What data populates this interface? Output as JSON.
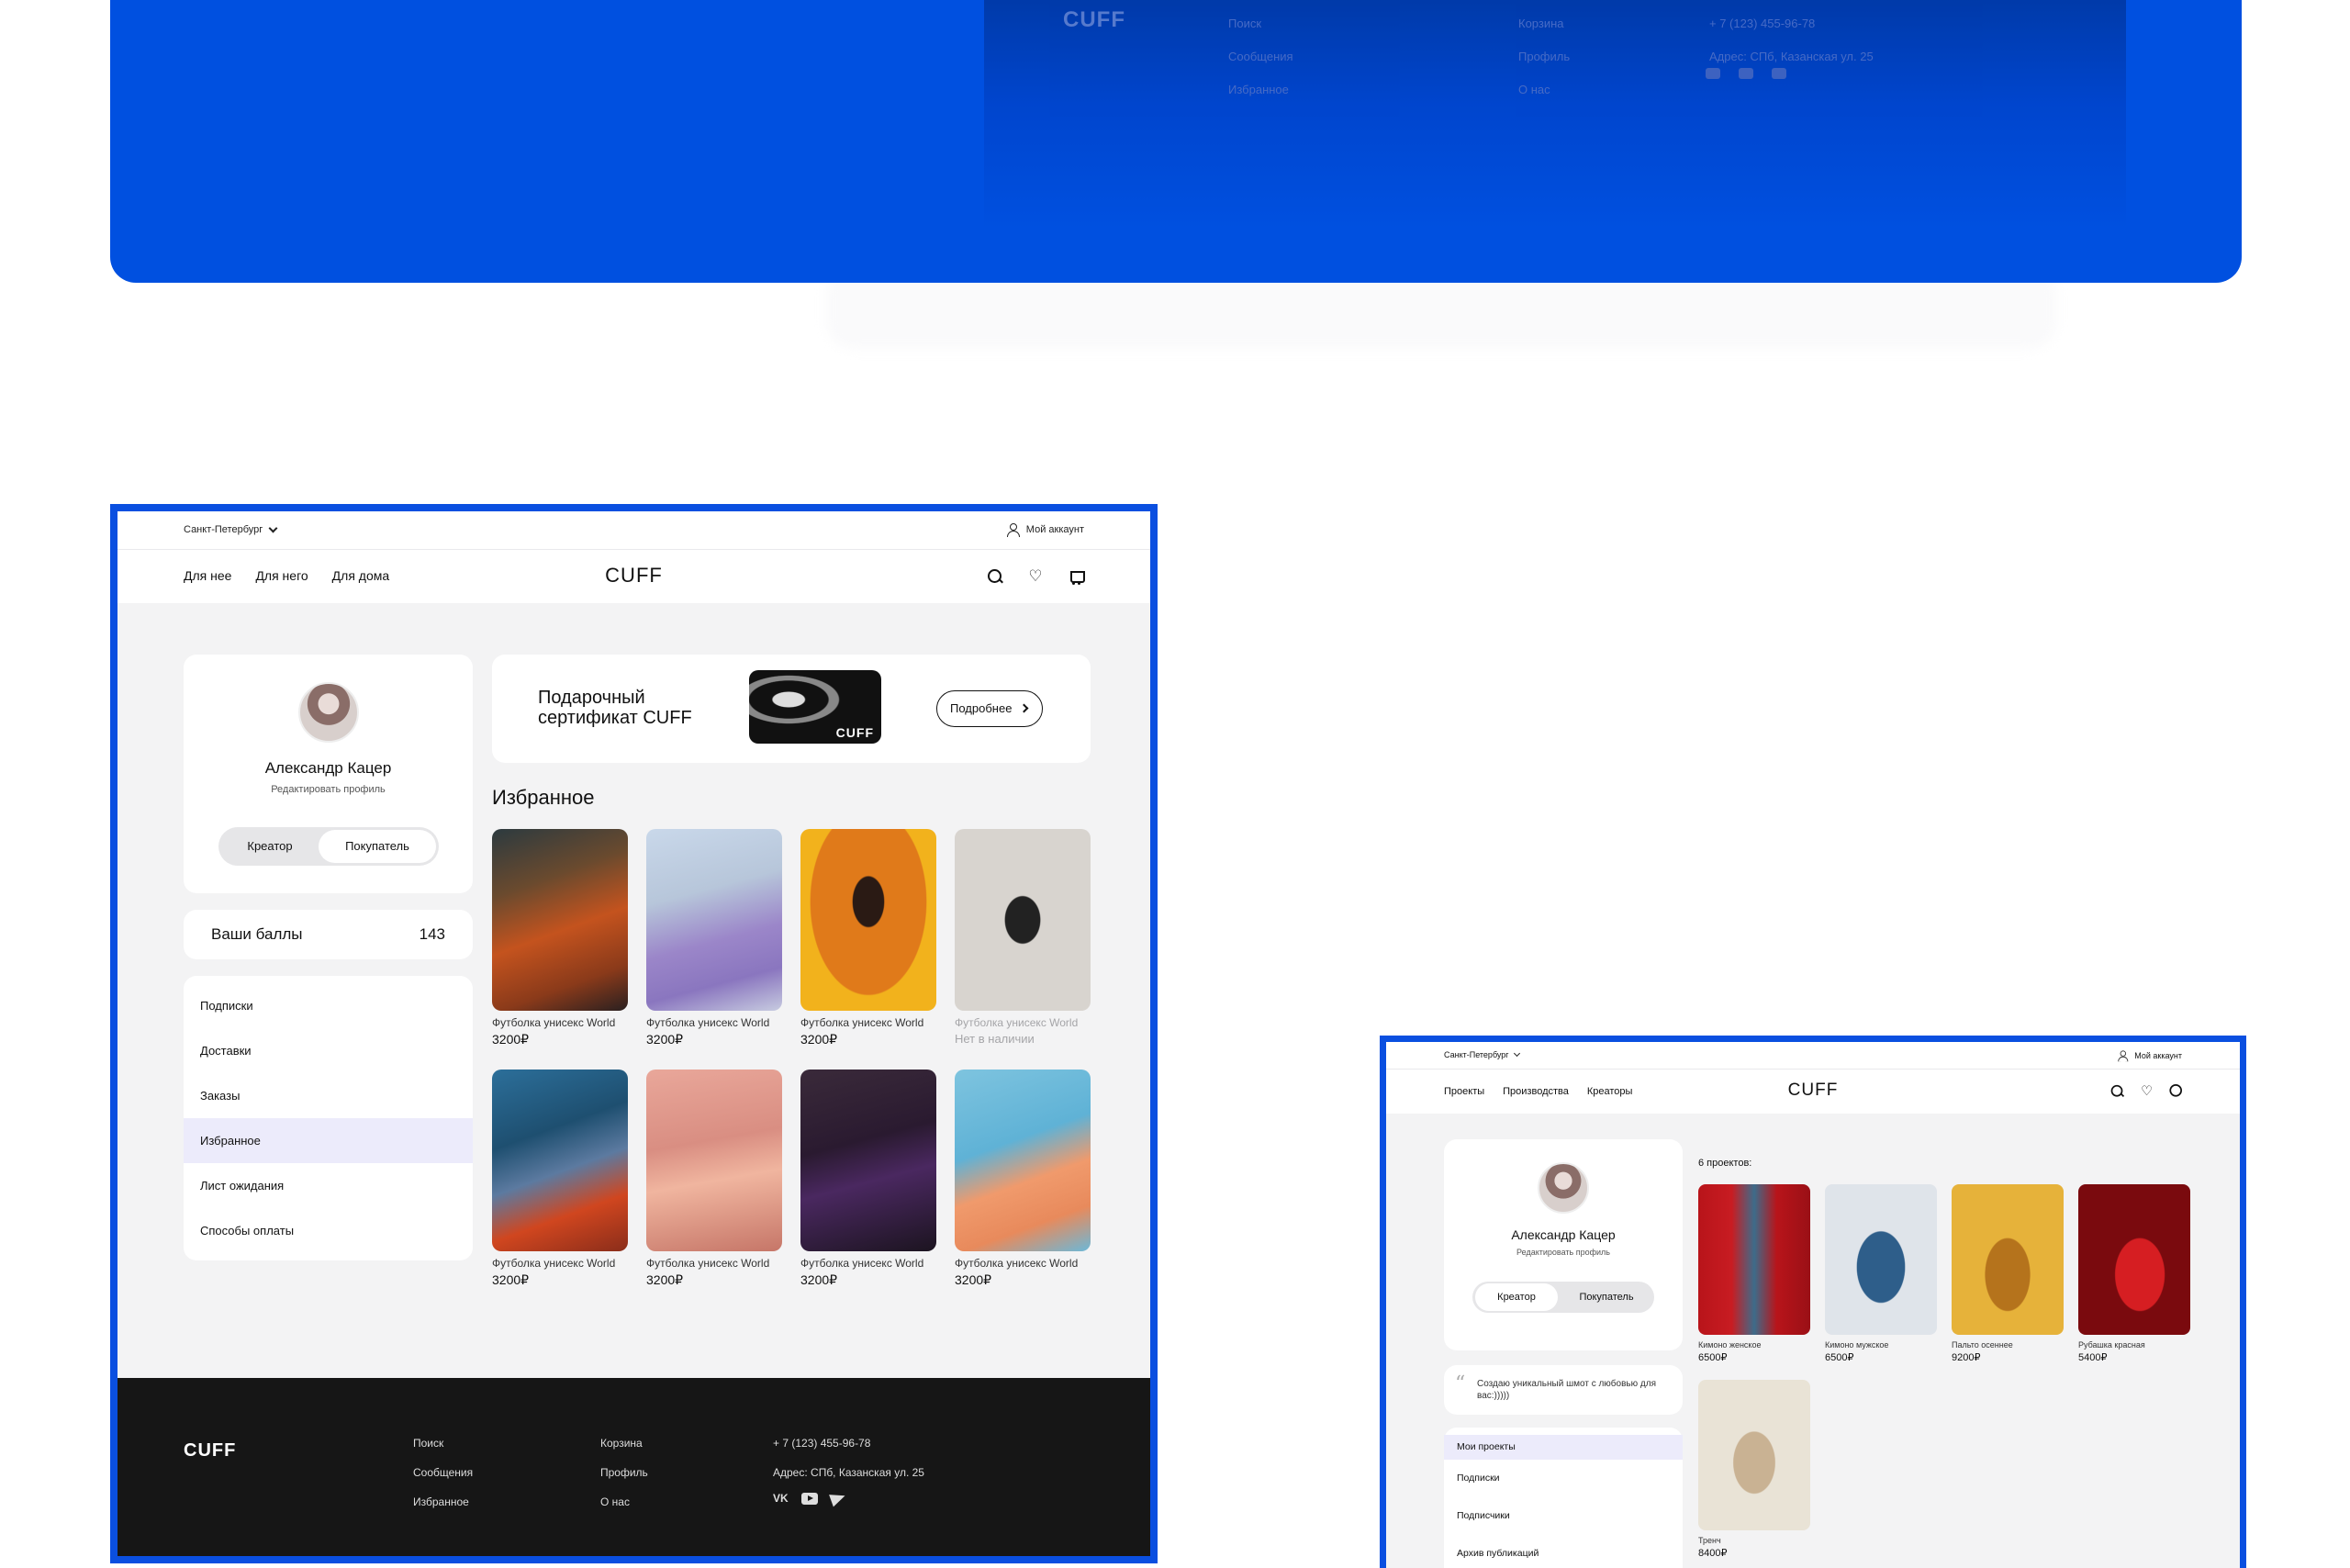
{
  "ghost_footer": {
    "logo": "CUFF",
    "col1": [
      "Поиск",
      "Сообщения",
      "Избранное"
    ],
    "col2": [
      "Корзина",
      "Профиль",
      "О нас"
    ],
    "phone": "+ 7 (123) 455-96-78",
    "address": "Адрес: СПб, Казанская ул. 25"
  },
  "frame1": {
    "city": "Санкт-Петербург",
    "account": "Мой аккаунт",
    "nav": [
      "Для нее",
      "Для него",
      "Для дома"
    ],
    "logo": "CUFF",
    "icons": [
      "search-icon",
      "heart-icon",
      "cart-icon"
    ],
    "profile": {
      "name": "Александр Кацер",
      "edit": "Редактировать профиль",
      "toggle_left": "Креатор",
      "toggle_right": "Покупатель"
    },
    "points": {
      "label": "Ваши баллы",
      "value": "143"
    },
    "menu": [
      "Подписки",
      "Доставки",
      "Заказы",
      "Избранное",
      "Лист ожидания",
      "Способы оплаты"
    ],
    "menu_active": "Избранное",
    "gift": {
      "title": "Подарочный сертификат CUFF",
      "image_logo": "CUFF",
      "button": "Подробнее"
    },
    "favorites_title": "Избранное",
    "products": [
      {
        "name": "Футболка унисекс World",
        "price": "3200₽",
        "available": true
      },
      {
        "name": "Футболка унисекс World",
        "price": "3200₽",
        "available": true
      },
      {
        "name": "Футболка унисекс World",
        "price": "3200₽",
        "available": true
      },
      {
        "name": "Футболка унисекс World",
        "price": "Нет в наличии",
        "available": false
      },
      {
        "name": "Футболка унисекс World",
        "price": "3200₽",
        "available": true
      },
      {
        "name": "Футболка унисекс World",
        "price": "3200₽",
        "available": true
      },
      {
        "name": "Футболка унисекс World",
        "price": "3200₽",
        "available": true
      },
      {
        "name": "Футболка унисекс World",
        "price": "3200₽",
        "available": true
      }
    ],
    "footer": {
      "logo": "CUFF",
      "col1": [
        "Поиск",
        "Сообщения",
        "Избранное"
      ],
      "col2": [
        "Корзина",
        "Профиль",
        "О нас"
      ],
      "phone": "+ 7 (123) 455-96-78",
      "address": "Адрес: СПб, Казанская ул. 25",
      "vk": "VK"
    }
  },
  "frame2": {
    "city": "Санкт-Петербург",
    "account": "Мой аккаунт",
    "nav": [
      "Проекты",
      "Производства",
      "Креаторы"
    ],
    "logo": "CUFF",
    "profile": {
      "name": "Александр Кацер",
      "edit": "Редактировать профиль",
      "toggle_left": "Креатор",
      "toggle_right": "Покупатель"
    },
    "quote": "Создаю уникальный шмот с любовью для вас:)))))",
    "menu": [
      "Мои проекты",
      "Подписки",
      "Подписчики",
      "Архив публикаций"
    ],
    "projects_title": "6 проектов:",
    "projects": [
      {
        "name": "Кимоно женское",
        "price": "6500₽"
      },
      {
        "name": "Кимоно мужское",
        "price": "6500₽"
      },
      {
        "name": "Пальто осеннее",
        "price": "9200₽"
      },
      {
        "name": "Рубашка красная",
        "price": "5400₽"
      },
      {
        "name": "Тренч",
        "price": "8400₽"
      }
    ]
  }
}
